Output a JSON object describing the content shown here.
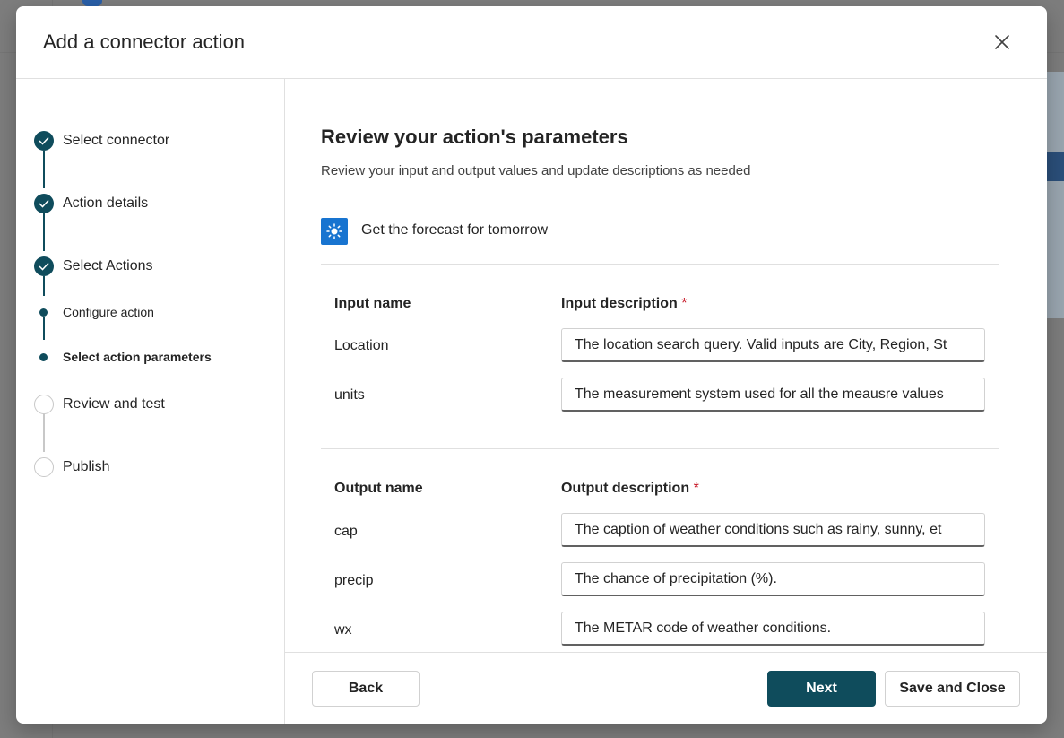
{
  "dialog": {
    "title": "Add a connector action",
    "close_icon": "close-icon"
  },
  "steps": [
    {
      "label": "Select connector",
      "status": "done"
    },
    {
      "label": "Action details",
      "status": "done"
    },
    {
      "label": "Select Actions",
      "status": "done"
    },
    {
      "label": "Configure action",
      "status": "substep-done"
    },
    {
      "label": "Select action parameters",
      "status": "substep-current"
    },
    {
      "label": "Review and test",
      "status": "pending"
    },
    {
      "label": "Publish",
      "status": "pending"
    }
  ],
  "main": {
    "title": "Review your action's parameters",
    "subtitle": "Review your input and output values and update descriptions as needed",
    "action_name": "Get the forecast for tomorrow",
    "action_icon": "weather-sun-icon",
    "inputs": {
      "name_header": "Input name",
      "desc_header": "Input description",
      "required_mark": "*",
      "rows": [
        {
          "name": "Location",
          "description": "The location search query. Valid inputs are City, Region, St"
        },
        {
          "name": "units",
          "description": "The measurement system used for all the meausre values"
        }
      ]
    },
    "outputs": {
      "name_header": "Output name",
      "desc_header": "Output description",
      "required_mark": "*",
      "rows": [
        {
          "name": "cap",
          "description": "The caption of weather conditions such as rainy, sunny, et"
        },
        {
          "name": "precip",
          "description": "The chance of precipitation (%)."
        },
        {
          "name": "wx",
          "description": "The METAR code of weather conditions."
        }
      ]
    }
  },
  "footer": {
    "back_label": "Back",
    "next_label": "Next",
    "save_close_label": "Save and Close"
  },
  "colors": {
    "accent": "#0f4c5c",
    "action_icon_bg": "#1874d0",
    "required": "#c50f1f"
  }
}
